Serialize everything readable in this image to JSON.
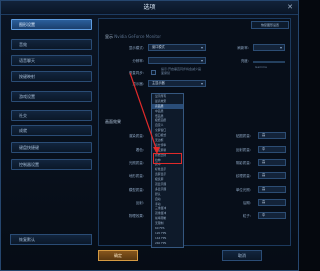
{
  "window": {
    "title": "选项",
    "close_label": "✕"
  },
  "nav": {
    "items": [
      {
        "label": "图形设置",
        "active": true
      },
      {
        "label": "音效"
      },
      {
        "label": "语音聊天"
      },
      {
        "label": "按键映射"
      },
      {
        "label": "游戏设置"
      },
      {
        "label": "社交"
      },
      {
        "label": "成就"
      },
      {
        "label": "键盘快捷键"
      },
      {
        "label": "控制器设置"
      }
    ],
    "reset_label": "恢复默认"
  },
  "panel": {
    "top_link_label": "恢复图形设置",
    "display": {
      "title": "显示",
      "subtitle": "Nvidia GeForce Monitor",
      "rows": [
        {
          "label": "显示模式:",
          "value": "窗口模式"
        },
        {
          "label": "分辨率:",
          "value": ""
        },
        {
          "label": "垂直同步:",
          "value": ""
        },
        {
          "label": "显示器:",
          "value": "主显示器"
        }
      ],
      "right_rows": [
        {
          "label": "刷新率:",
          "value": ""
        },
        {
          "label": "亮度:",
          "value": ""
        }
      ],
      "vsync_hint": "提示:开启垂直同步将会减少画面撕裂",
      "gamma_hint": "Gamma"
    },
    "quality": {
      "title": "画面效果",
      "left_rows": [
        {
          "label": "渲染质量:",
          "value": ""
        },
        {
          "label": "着色:",
          "value": ""
        },
        {
          "label": "光照质量:",
          "value": ""
        },
        {
          "label": "地形质量:",
          "value": ""
        },
        {
          "label": "模型质量:",
          "value": ""
        },
        {
          "label": "反射:",
          "value": ""
        },
        {
          "label": "物理效果:",
          "value": ""
        }
      ],
      "right_rows": [
        {
          "label": "贴图质量:",
          "value": "高"
        },
        {
          "label": "反射质量:",
          "value": "中"
        },
        {
          "label": "阴影质量:",
          "value": "高"
        },
        {
          "label": "纹理质量:",
          "value": "高"
        },
        {
          "label": "单位光照:",
          "value": "高"
        },
        {
          "label": "后期:",
          "value": "高"
        },
        {
          "label": "粒子:",
          "value": "中"
        }
      ]
    },
    "dropdown_items": [
      "显示所有",
      "最高效果",
      "高画质",
      "中画质",
      "低画质",
      "极低画质",
      "自定义",
      "全屏窗口",
      "窗口模式",
      "无边框",
      "高分辨率",
      "适应屏幕",
      "原始比例",
      "拉伸",
      "居中",
      "标准显示",
      "宽屏显示",
      "极宽屏",
      "双显示器",
      "多显示器",
      "默认",
      "自动",
      "手动",
      "三重缓冲",
      "双重缓冲",
      "帧率限制",
      "无限制",
      "60 FPS",
      "120 FPS",
      "144 FPS",
      "240 FPS"
    ],
    "dropdown_selected_index": 2
  },
  "footer": {
    "ok_label": "确定",
    "cancel_label": "取消"
  },
  "colors": {
    "accent": "#5e9ce0",
    "ok": "#d49a42",
    "annotation": "#e02a2a"
  }
}
